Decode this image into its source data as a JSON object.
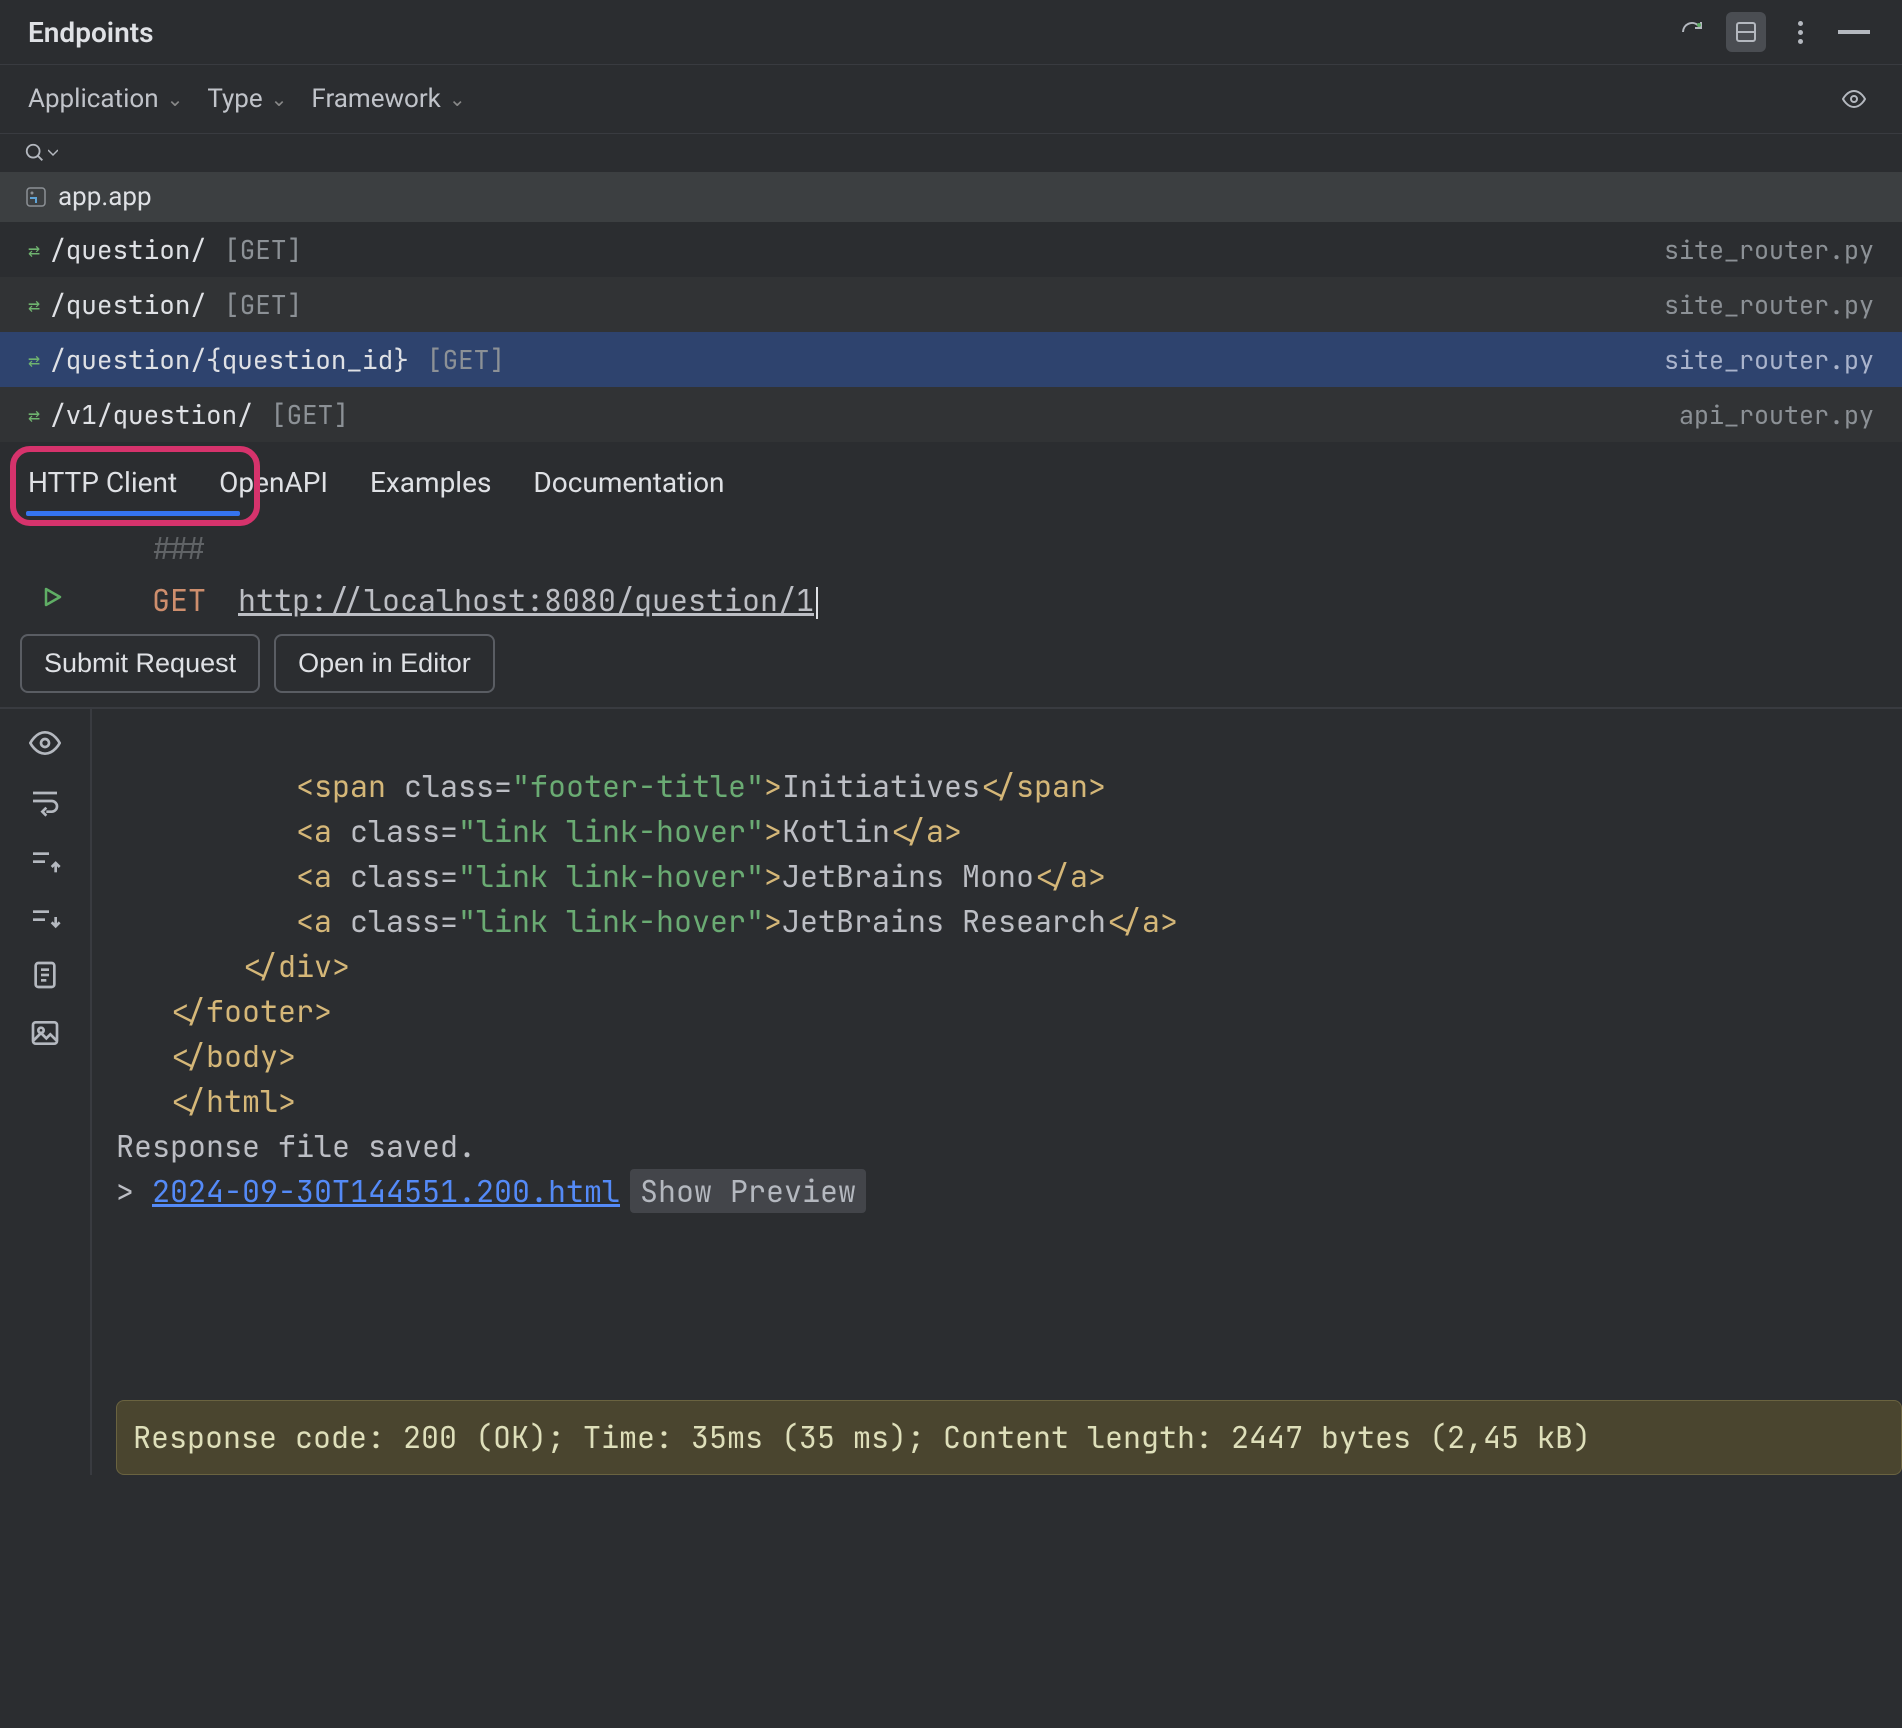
{
  "window": {
    "title": "Endpoints"
  },
  "filters": {
    "application": "Application",
    "type": "Type",
    "framework": "Framework"
  },
  "app_group": "app.app",
  "endpoints": [
    {
      "icon": "route-icon",
      "path": "/question/",
      "method": "[GET]",
      "source": "site_router.py",
      "selected": false
    },
    {
      "icon": "route-icon",
      "path": "/question/",
      "method": "[GET]",
      "source": "site_router.py",
      "selected": false
    },
    {
      "icon": "route-icon",
      "path": "/question/{question_id}",
      "method": "[GET]",
      "source": "site_router.py",
      "selected": true
    },
    {
      "icon": "route-icon",
      "path": "/v1/question/",
      "method": "[GET]",
      "source": "api_router.py",
      "selected": false
    }
  ],
  "tabs": {
    "http_client": "HTTP Client",
    "openapi": "OpenAPI",
    "examples": "Examples",
    "documentation": "Documentation"
  },
  "request": {
    "separator": "###",
    "method": "GET",
    "url": "http://localhost:8080/question/1"
  },
  "buttons": {
    "submit": "Submit Request",
    "open_editor": "Open in Editor"
  },
  "response": {
    "lines": [
      {
        "indent": "          ",
        "raw": "<span class=\"footer-title\">Initiatives</span>",
        "tag1": "span",
        "attr": "class",
        "val": "footer-title",
        "text": "Initiatives"
      },
      {
        "indent": "          ",
        "raw": "<a class=\"link link-hover\">Kotlin</a>",
        "tag1": "a",
        "attr": "class",
        "val": "link link-hover",
        "text": "Kotlin"
      },
      {
        "indent": "          ",
        "raw": "<a class=\"link link-hover\">JetBrains Mono</a>",
        "tag1": "a",
        "attr": "class",
        "val": "link link-hover",
        "text": "JetBrains Mono"
      },
      {
        "indent": "          ",
        "raw": "<a class=\"link link-hover\">JetBrains Research</a>",
        "tag1": "a",
        "attr": "class",
        "val": "link link-hover",
        "text": "JetBrains Research"
      }
    ],
    "closing_div": "</div>",
    "closing_footer": "</footer>",
    "closing_body": "</body>",
    "closing_html": "</html>",
    "saved_msg": "Response file saved.",
    "file_link": "2024-09-30T144551.200.html",
    "show_preview": "Show Preview",
    "status": "Response code: 200 (OK); Time: 35ms (35 ms); Content length: 2447 bytes (2,45 kB)"
  }
}
